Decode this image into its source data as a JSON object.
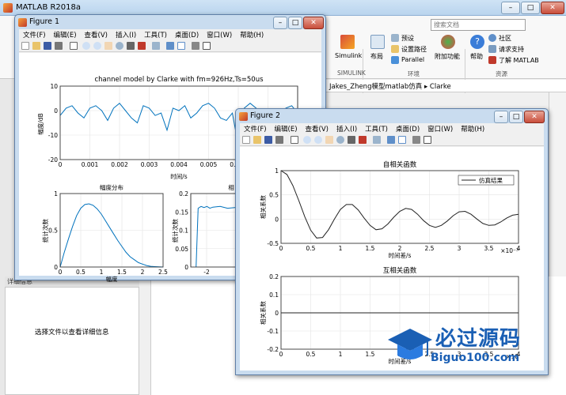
{
  "app": {
    "title": "MATLAB R2018a"
  },
  "search": {
    "placeholder": "搜索文档"
  },
  "ribbon": {
    "simulink_label": "Simulink",
    "layout_label": "布局",
    "preferences_label": "预设",
    "set_path_label": "设置路径",
    "parallel_label": "Parallel",
    "addons_label": "附加功能",
    "help_label": "帮助",
    "community_label": "社区",
    "request_support_label": "请求支持",
    "learn_matlab_label": "了解 MATLAB",
    "section_simulink": "SIMULINK",
    "section_env": "环境",
    "section_resources": "资源"
  },
  "address": {
    "path": "Jakes_Zheng模型matlab仿真 ▸ Clarke"
  },
  "details": {
    "header": "详细信息",
    "text": "选择文件以查看详细信息"
  },
  "menus": [
    "文件(F)",
    "编辑(E)",
    "查看(V)",
    "插入(I)",
    "工具(T)",
    "桌面(D)",
    "窗口(W)",
    "帮助(H)"
  ],
  "figure1": {
    "title": "Figure 1",
    "top_title": "channel model by Clarke with fm=926Hz,Ts=50us",
    "top_xlabel": "时间/s",
    "top_ylabel": "幅度/dB",
    "bl_title": "幅度分布",
    "bl_xlabel": "幅度",
    "bl_ylabel": "统计次数",
    "br_title": "相",
    "br_ylabel": "统计次数"
  },
  "figure2": {
    "title": "Figure 2",
    "top_title": "自相关函数",
    "top_xlabel": "时间差/s",
    "top_ylabel": "相关系数",
    "legend": "仿真结果",
    "exp_label": "×10⁻³",
    "bottom_title": "互相关函数",
    "bottom_xlabel": "时间差/s",
    "bottom_ylabel": "相关系数",
    "exp_label2": "×10"
  },
  "watermark": {
    "title": "必过源码",
    "url": "Biguo100.com"
  },
  "chart_data": [
    {
      "type": "line",
      "title": "channel model by Clarke with fm=926Hz,Ts=50us",
      "xlabel": "时间/s",
      "ylabel": "幅度/dB",
      "xlim": [
        0,
        0.008
      ],
      "ylim": [
        -20,
        10
      ],
      "xticks": [
        "0",
        "0.001",
        "0.002",
        "0.003",
        "0.004",
        "0.005",
        "0.006",
        "0.007"
      ],
      "yticks": [
        "10",
        "0",
        "-10",
        "-20"
      ],
      "x": [
        0,
        0.0002,
        0.0004,
        0.0006,
        0.0008,
        0.001,
        0.0012,
        0.0014,
        0.0016,
        0.0018,
        0.002,
        0.0022,
        0.0024,
        0.0026,
        0.0028,
        0.003,
        0.0032,
        0.0034,
        0.0036,
        0.0038,
        0.004,
        0.0042,
        0.0044,
        0.0046,
        0.0048,
        0.005,
        0.0052,
        0.0054,
        0.0056,
        0.0058,
        0.006,
        0.0062,
        0.0064,
        0.0066,
        0.0068,
        0.007,
        0.0072,
        0.0074,
        0.0076,
        0.0078,
        0.008
      ],
      "y": [
        -2,
        1,
        2,
        -1,
        -3,
        1,
        2,
        0,
        -4,
        1,
        3,
        0,
        -3,
        -5,
        2,
        1,
        -2,
        -1,
        -8,
        1,
        0,
        2,
        -3,
        -1,
        2,
        3,
        1,
        -3,
        -4,
        -1,
        -14,
        1,
        3,
        1,
        -2,
        -1,
        0,
        -3,
        1,
        2,
        -1
      ],
      "grid": true
    },
    {
      "type": "bar",
      "title": "幅度分布",
      "xlabel": "幅度",
      "ylabel": "统计次数",
      "xlim": [
        0,
        2.5
      ],
      "ylim": [
        0,
        1
      ],
      "xticks": [
        "0",
        "0.5",
        "1",
        "1.5",
        "2",
        "2.5"
      ],
      "yticks": [
        "1",
        "0.5",
        "0"
      ],
      "x": [
        0,
        0.1,
        0.2,
        0.3,
        0.4,
        0.5,
        0.6,
        0.7,
        0.8,
        0.9,
        1.0,
        1.1,
        1.2,
        1.3,
        1.4,
        1.5,
        1.6,
        1.7,
        1.8,
        1.9,
        2.0,
        2.1,
        2.2,
        2.3,
        2.4,
        2.5
      ],
      "y": [
        0,
        0.2,
        0.38,
        0.55,
        0.7,
        0.8,
        0.85,
        0.86,
        0.84,
        0.79,
        0.72,
        0.63,
        0.54,
        0.45,
        0.36,
        0.28,
        0.2,
        0.14,
        0.1,
        0.06,
        0.04,
        0.02,
        0.01,
        0.005,
        0.002,
        0
      ],
      "grid": true
    },
    {
      "type": "bar",
      "title": "相",
      "ylabel": "统计次数",
      "xlim": [
        -3.5,
        3.5
      ],
      "ylim": [
        0,
        0.2
      ],
      "xticks": [
        "-2",
        "0"
      ],
      "yticks": [
        "0.2",
        "0.15",
        "0.1",
        "0.05",
        "0"
      ],
      "x": [
        -3.14,
        -3,
        -2.8,
        -2.6,
        -2.4,
        -2.2,
        -2,
        -1.5,
        -1,
        -0.5,
        0,
        0.5
      ],
      "y": [
        0,
        0.16,
        0.165,
        0.162,
        0.165,
        0.16,
        0.163,
        0.165,
        0.16,
        0.162,
        0.164,
        0.16
      ],
      "grid": true
    },
    {
      "type": "line",
      "title": "自相关函数",
      "xlabel": "时间差/s",
      "ylabel": "相关系数",
      "xlim": [
        0,
        0.004
      ],
      "ylim": [
        -0.5,
        1
      ],
      "xticks": [
        "0",
        "0.5",
        "1",
        "1.5",
        "2",
        "2.5",
        "3",
        "3.5",
        "4"
      ],
      "yticks": [
        "1",
        "0.5",
        "0",
        "-0.5"
      ],
      "x": [
        0,
        0.0001,
        0.0002,
        0.0003,
        0.0004,
        0.0005,
        0.0006,
        0.0007,
        0.0008,
        0.0009,
        0.001,
        0.0011,
        0.0012,
        0.0013,
        0.0014,
        0.0015,
        0.0016,
        0.0017,
        0.0018,
        0.0019,
        0.002,
        0.0021,
        0.0022,
        0.0023,
        0.0024,
        0.0025,
        0.0026,
        0.0027,
        0.0028,
        0.0029,
        0.003,
        0.0031,
        0.0032,
        0.0033,
        0.0034,
        0.0035,
        0.0036,
        0.0037,
        0.0038,
        0.0039,
        0.004
      ],
      "y": [
        1,
        0.92,
        0.69,
        0.38,
        0.05,
        -0.23,
        -0.39,
        -0.38,
        -0.22,
        0,
        0.2,
        0.3,
        0.3,
        0.19,
        0.02,
        -0.13,
        -0.22,
        -0.2,
        -0.1,
        0.04,
        0.16,
        0.22,
        0.2,
        0.1,
        -0.03,
        -0.13,
        -0.17,
        -0.13,
        -0.04,
        0.07,
        0.15,
        0.16,
        0.1,
        0,
        -0.09,
        -0.13,
        -0.12,
        -0.06,
        0.02,
        0.08,
        0.1
      ],
      "series_name": "仿真结果",
      "grid": true
    },
    {
      "type": "line",
      "title": "互相关函数",
      "xlabel": "时间差/s",
      "ylabel": "相关系数",
      "xlim": [
        0,
        0.004
      ],
      "ylim": [
        -0.2,
        0.2
      ],
      "xticks": [
        "0",
        "0.5",
        "1",
        "1.5",
        "2",
        "2.5",
        "3",
        "3.5",
        "4"
      ],
      "yticks": [
        "0.2",
        "0.1",
        "0",
        "-0.1",
        "-0.2"
      ],
      "x": [
        0,
        0.004
      ],
      "y": [
        0,
        0
      ],
      "grid": true
    }
  ]
}
